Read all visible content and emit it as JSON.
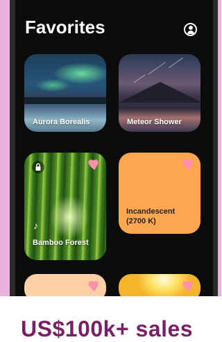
{
  "header": {
    "title": "Favorites",
    "profile_icon": "account-circle-icon"
  },
  "cards": [
    {
      "label": "Aurora Borealis"
    },
    {
      "label": "Meteor Shower"
    },
    {
      "label": "Bamboo Forest"
    },
    {
      "label_line1": "Incandescent",
      "label_line2": "(2700 K)"
    },
    {
      "label": ""
    },
    {
      "label": ""
    }
  ],
  "banner": {
    "text": "US$100k+ sales"
  },
  "colors": {
    "accent_heart": "#ff8fb1",
    "incandescent": "#ffa650",
    "peach": "#ffcfa5",
    "banner_text": "#7a1f65",
    "background_pink": "#eab3de"
  }
}
